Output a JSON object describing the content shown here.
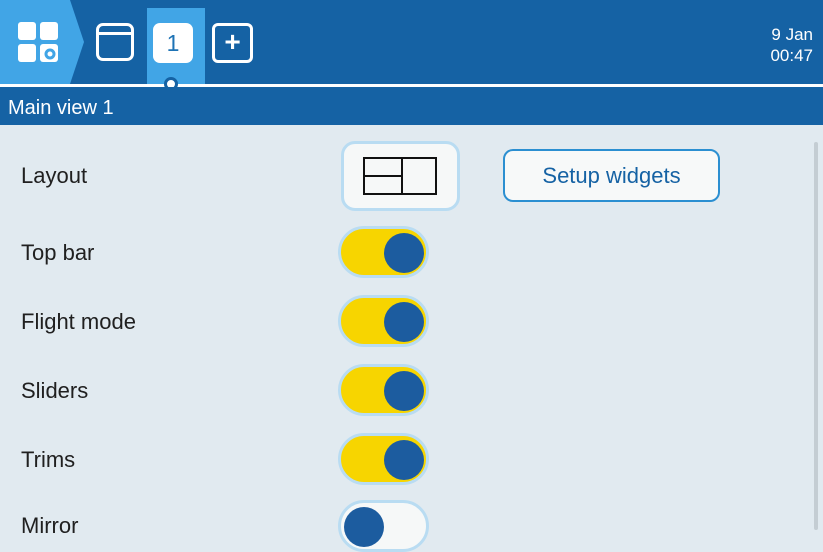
{
  "header": {
    "icons": [
      "model-select-icon",
      "layout-tab-icon",
      "add-tab-icon"
    ],
    "active_tab_label": "1",
    "add_tab_label": "+",
    "date": "9 Jan",
    "time": "00:47",
    "colors": {
      "bar": "#1562a4",
      "active_tab": "#41a5e6"
    }
  },
  "page": {
    "title": "Main view 1"
  },
  "settings": {
    "layout_label": "Layout",
    "setup_widgets_label": "Setup widgets",
    "rows": [
      {
        "label": "Top bar",
        "enabled": true
      },
      {
        "label": "Flight mode",
        "enabled": true
      },
      {
        "label": "Sliders",
        "enabled": true
      },
      {
        "label": "Trims",
        "enabled": true
      },
      {
        "label": "Mirror",
        "enabled": false
      }
    ]
  },
  "colors": {
    "background": "#e1eaf0",
    "toggle_on": "#f7d500",
    "toggle_knob": "#1c5c9f",
    "toggle_border": "#b9dcf2"
  }
}
